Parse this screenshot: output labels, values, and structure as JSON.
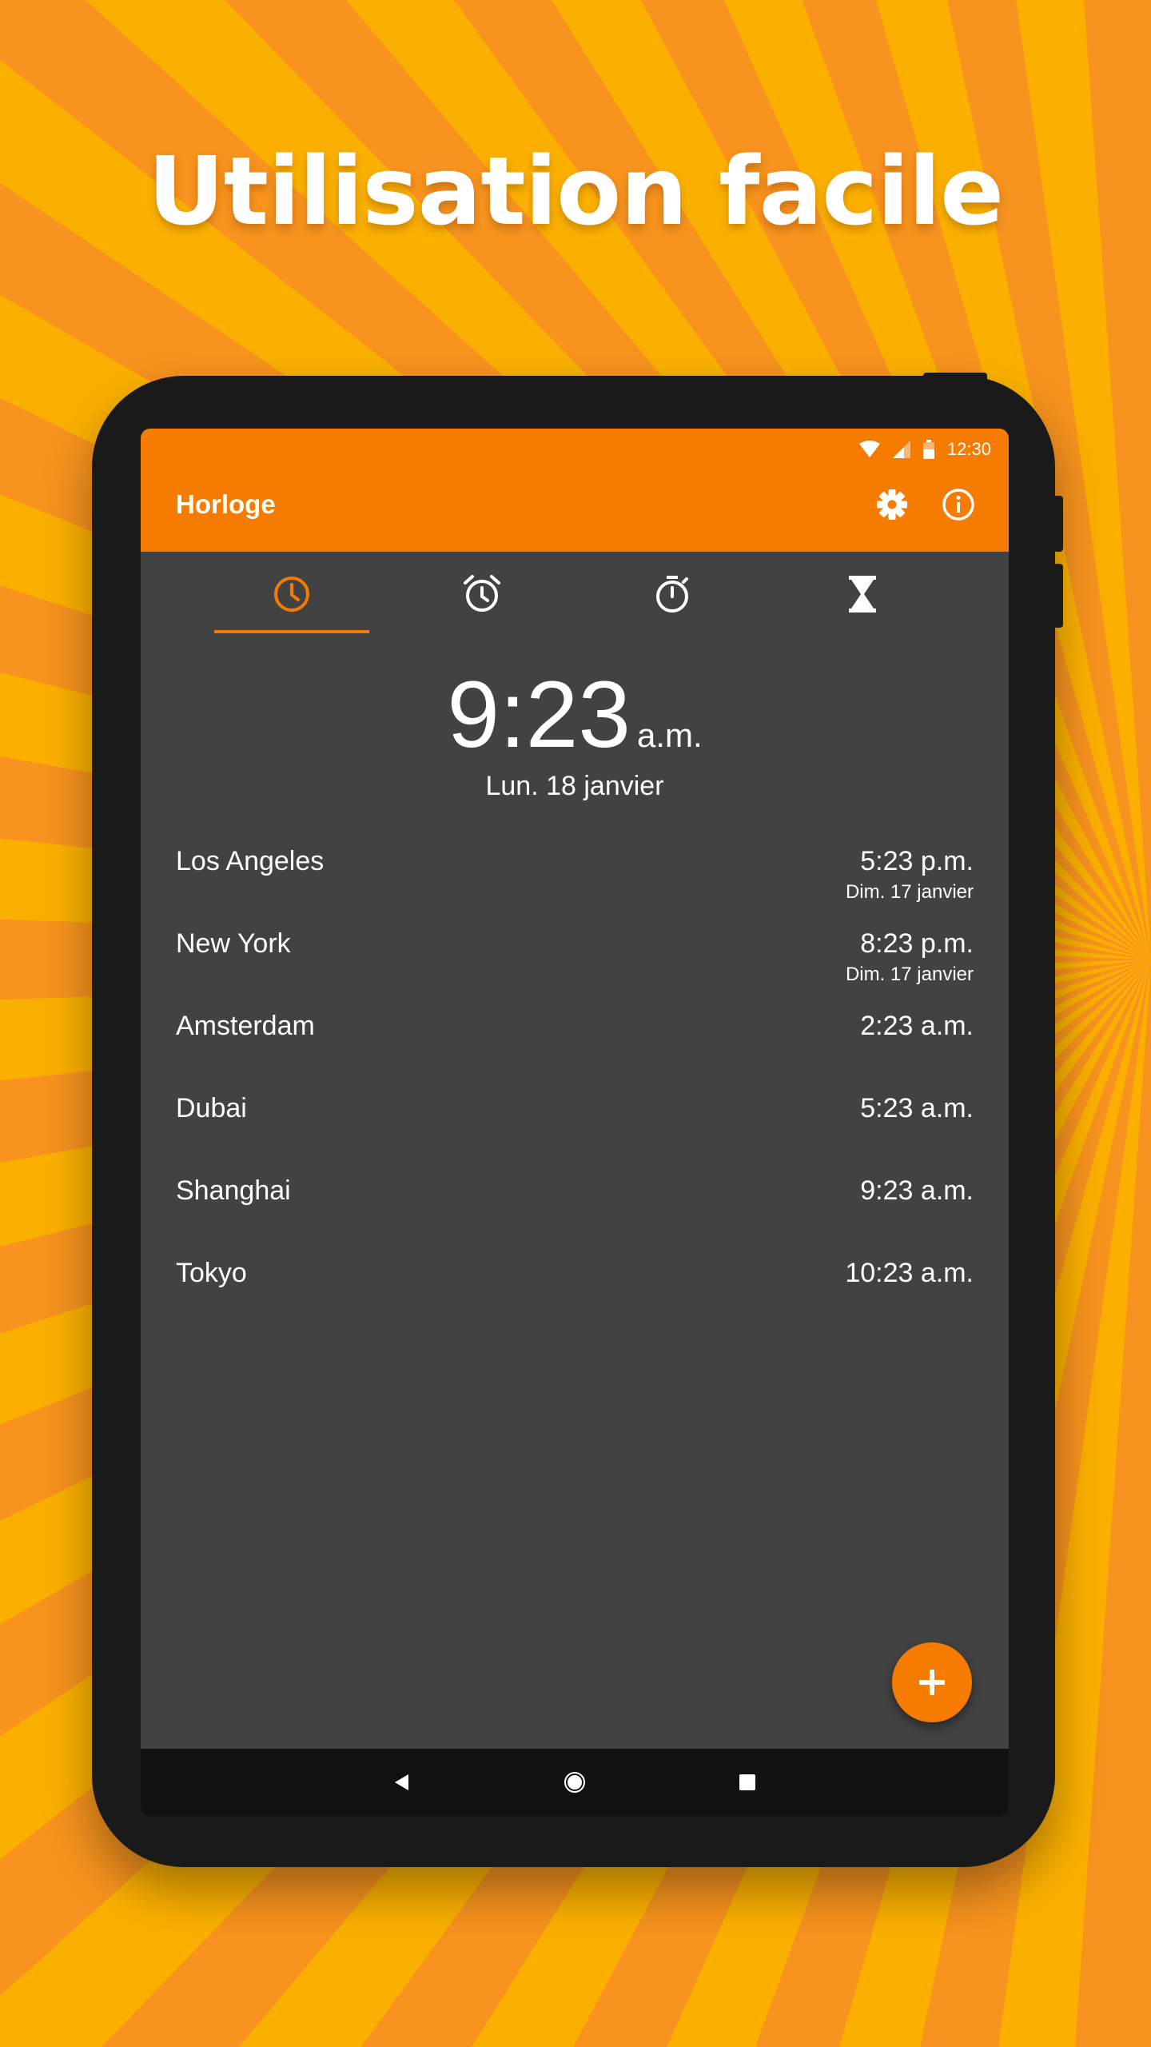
{
  "headline": "Utilisation facile",
  "status_bar": {
    "time": "12:30",
    "icons": [
      "wifi-icon",
      "signal-icon",
      "battery-icon"
    ]
  },
  "app_bar": {
    "title": "Horloge",
    "actions": [
      "settings-gear-icon",
      "info-icon"
    ]
  },
  "tabs": [
    {
      "icon": "clock-icon",
      "selected": true
    },
    {
      "icon": "alarm-icon",
      "selected": false
    },
    {
      "icon": "stopwatch-icon",
      "selected": false
    },
    {
      "icon": "hourglass-timer-icon",
      "selected": false
    }
  ],
  "local_time": {
    "time": "9:23",
    "ampm": "a.m.",
    "date": "Lun. 18 janvier"
  },
  "cities": [
    {
      "name": "Los Angeles",
      "time": "5:23 p.m.",
      "date": "Dim. 17 janvier"
    },
    {
      "name": "New York",
      "time": "8:23 p.m.",
      "date": "Dim. 17 janvier"
    },
    {
      "name": "Amsterdam",
      "time": "2:23 a.m.",
      "date": ""
    },
    {
      "name": "Dubai",
      "time": "5:23 a.m.",
      "date": ""
    },
    {
      "name": "Shanghai",
      "time": "9:23 a.m.",
      "date": ""
    },
    {
      "name": "Tokyo",
      "time": "10:23 a.m.",
      "date": ""
    }
  ],
  "fab": {
    "icon": "plus-icon"
  },
  "nav_bar": [
    "back-icon",
    "home-icon",
    "recents-icon"
  ],
  "colors": {
    "accent": "#f57c00",
    "screen_bg": "#424242",
    "nav_bg": "#111111",
    "device": "#1a1a1a"
  }
}
